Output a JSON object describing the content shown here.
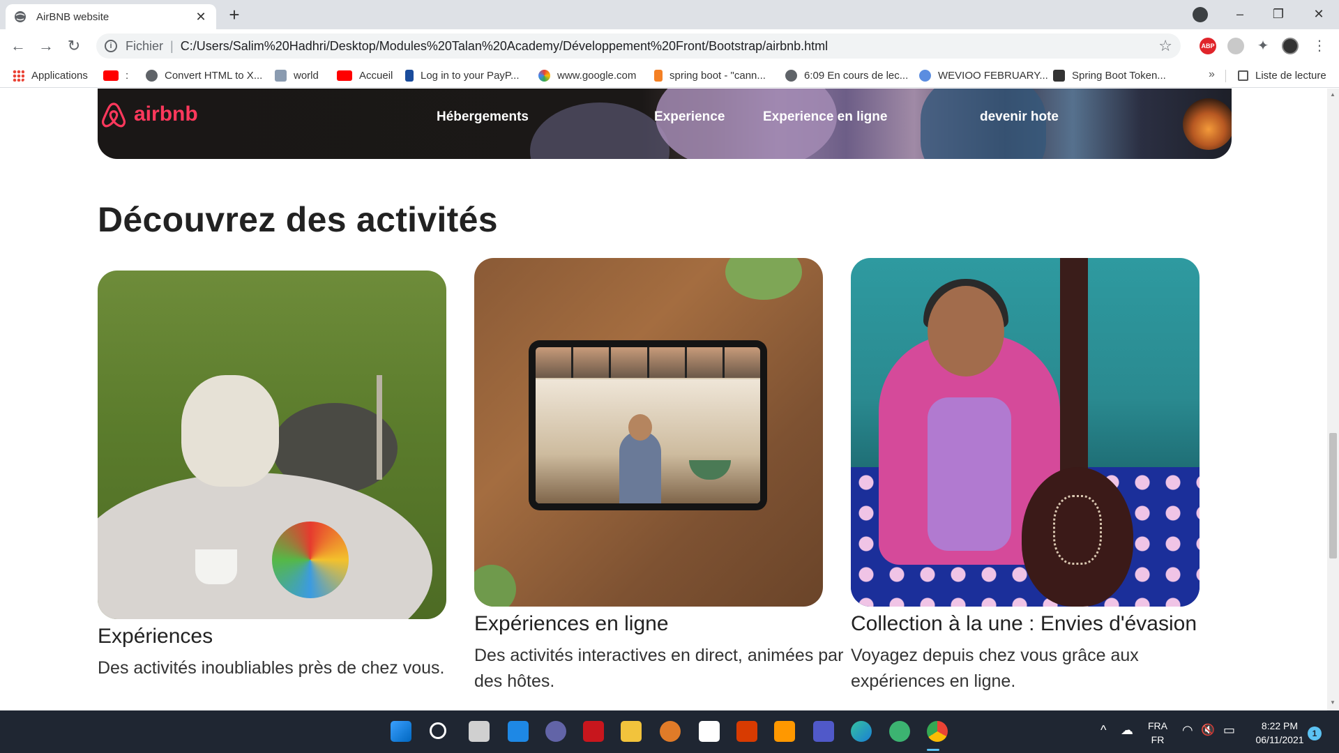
{
  "browser": {
    "tab_title": "AirBNB website",
    "tab_close": "✕",
    "new_tab": "+",
    "win_minimize": "–",
    "win_restore": "❐",
    "win_close": "✕",
    "back": "←",
    "forward": "→",
    "reload": "↻",
    "scheme_label": "Fichier",
    "separator": "|",
    "url": "C:/Users/Salim%20Hadhri/Desktop/Modules%20Talan%20Academy/Développement%20Front/Bootstrap/airbnb.html",
    "abp_label": "ABP",
    "bookmark_star": "☆",
    "extensions": "✦",
    "menu": "⋮"
  },
  "bookmarks": {
    "items": [
      {
        "label": "Applications"
      },
      {
        "label": ":"
      },
      {
        "label": "Convert HTML to X..."
      },
      {
        "label": "world"
      },
      {
        "label": "Accueil"
      },
      {
        "label": "Log in to your PayP..."
      },
      {
        "label": "www.google.com"
      },
      {
        "label": "spring boot - \"cann..."
      },
      {
        "label": "6:09 En cours de lec..."
      },
      {
        "label": "WEVIOO FEBRUARY..."
      },
      {
        "label": "Spring Boot Token..."
      }
    ],
    "more": "»",
    "reading_list": "Liste de lecture"
  },
  "hero": {
    "logo_text": "airbnb",
    "nav": {
      "hebergements": "Hébergements",
      "experience": "Experience",
      "experience_en_ligne": "Experience en ligne",
      "devenir_hote": "devenir hote"
    }
  },
  "section": {
    "title": "Découvrez des activités"
  },
  "cards": [
    {
      "title": "Expériences",
      "description": "Des activités inoubliables près de chez vous."
    },
    {
      "title": "Expériences en ligne",
      "description": "Des activités interactives en direct, animées par des hôtes."
    },
    {
      "title": "Collection à la une : Envies d'évasion",
      "description": "Voyagez depuis chez vous grâce aux expériences en ligne."
    }
  ],
  "taskbar": {
    "lang_top": "FRA",
    "lang_bottom": "FR",
    "time": "8:22 PM",
    "date": "06/11/2021",
    "notifications": "1",
    "tray_chevron": "^",
    "wifi": "◠",
    "volume": "🔇",
    "battery": "▭"
  },
  "colors": {
    "airbnb_red": "#ff385c",
    "taskbar_bg": "#1f2632",
    "tab_strip_bg": "#dee1e6"
  }
}
